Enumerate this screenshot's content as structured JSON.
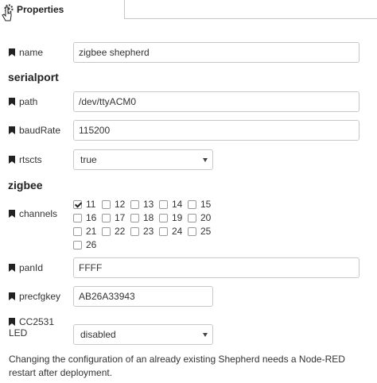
{
  "header": {
    "tab_label": "Properties"
  },
  "fields": {
    "name": {
      "label": "name",
      "value": "zigbee shepherd"
    },
    "path": {
      "label": "path",
      "value": "/dev/ttyACM0"
    },
    "baudRate": {
      "label": "baudRate",
      "value": "115200"
    },
    "rtscts": {
      "label": "rtscts",
      "value": "true"
    },
    "panId": {
      "label": "panId",
      "value": "FFFF"
    },
    "precfgkey": {
      "label": "precfgkey",
      "value": "AB26A33943"
    },
    "led": {
      "label_line1": "CC2531",
      "label_line2": "LED",
      "value": "disabled"
    }
  },
  "sections": {
    "serialport": "serialport",
    "zigbee": "zigbee"
  },
  "channels": {
    "label": "channels",
    "items": [
      {
        "num": "11",
        "checked": true
      },
      {
        "num": "12",
        "checked": false
      },
      {
        "num": "13",
        "checked": false
      },
      {
        "num": "14",
        "checked": false
      },
      {
        "num": "15",
        "checked": false
      },
      {
        "num": "16",
        "checked": false
      },
      {
        "num": "17",
        "checked": false
      },
      {
        "num": "18",
        "checked": false
      },
      {
        "num": "19",
        "checked": false
      },
      {
        "num": "20",
        "checked": false
      },
      {
        "num": "21",
        "checked": false
      },
      {
        "num": "22",
        "checked": false
      },
      {
        "num": "23",
        "checked": false
      },
      {
        "num": "24",
        "checked": false
      },
      {
        "num": "25",
        "checked": false
      },
      {
        "num": "26",
        "checked": false
      }
    ]
  },
  "footnote": "Changing the configuration of an already existing Shepherd needs a Node-RED restart after deployment.",
  "icons": {
    "tag": "bookmark-icon",
    "gear": "gear-icon",
    "cursor": "hand-cursor-icon"
  }
}
